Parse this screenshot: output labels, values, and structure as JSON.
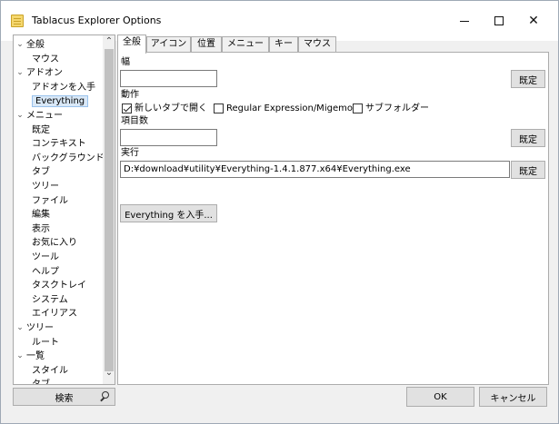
{
  "window": {
    "title": "Tablacus Explorer Options",
    "minimize_icon": "minimize-icon",
    "maximize_icon": "maximize-icon",
    "close_glyph": "✕"
  },
  "tree": {
    "items": [
      {
        "label": "全般",
        "expanded": true
      },
      {
        "label": "マウス"
      },
      {
        "label": "アドオン",
        "expanded": true
      },
      {
        "label": "アドオンを入手"
      },
      {
        "label": "Everything",
        "selected": true
      },
      {
        "label": "メニュー",
        "expanded": true
      },
      {
        "label": "既定"
      },
      {
        "label": "コンテキスト"
      },
      {
        "label": "バックグラウンド"
      },
      {
        "label": "タブ"
      },
      {
        "label": "ツリー"
      },
      {
        "label": "ファイル"
      },
      {
        "label": "編集"
      },
      {
        "label": "表示"
      },
      {
        "label": "お気に入り"
      },
      {
        "label": "ツール"
      },
      {
        "label": "ヘルプ"
      },
      {
        "label": "タスクトレイ"
      },
      {
        "label": "システム"
      },
      {
        "label": "エイリアス"
      },
      {
        "label": "ツリー",
        "expanded": true
      },
      {
        "label": "ルート"
      },
      {
        "label": "一覧",
        "expanded": true
      },
      {
        "label": "スタイル"
      },
      {
        "label": "タブ"
      }
    ],
    "search_label": "検索"
  },
  "tabs": [
    "全般",
    "アイコン",
    "位置",
    "メニュー",
    "キー",
    "マウス"
  ],
  "form": {
    "width_label": "幅",
    "width_value": "",
    "default_label": "既定",
    "action_label": "動作",
    "checkbox_new_tab": {
      "label": "新しいタブで開く",
      "checked": true
    },
    "checkbox_regex": {
      "label": "Regular Expression/Migemo",
      "checked": false
    },
    "checkbox_subfolder": {
      "label": "サブフォルダー",
      "checked": false
    },
    "items_label": "項目数",
    "items_value": "",
    "exec_label": "実行",
    "exec_value": "D:¥download¥utility¥Everything-1.4.1.877.x64¥Everything.exe",
    "get_button": "Everything を入手..."
  },
  "footer": {
    "ok": "OK",
    "cancel": "キャンセル"
  }
}
